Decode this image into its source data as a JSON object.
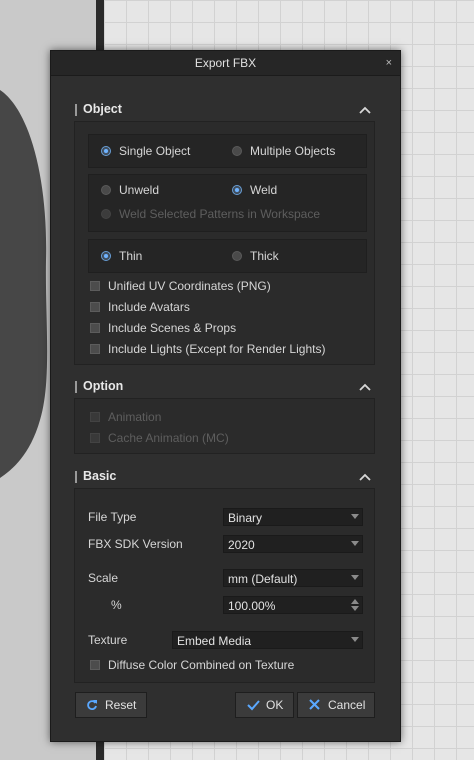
{
  "dialog": {
    "title": "Export FBX",
    "close_glyph": "×"
  },
  "sections": {
    "object": {
      "title": "Object",
      "object_mode": {
        "options": [
          "Single Object",
          "Multiple Objects"
        ],
        "selected": "Single Object"
      },
      "weld_mode": {
        "options": [
          "Unweld",
          "Weld"
        ],
        "selected": "Weld"
      },
      "weld_patterns_label": "Weld Selected Patterns in Workspace",
      "thickness": {
        "options": [
          "Thin",
          "Thick"
        ],
        "selected": "Thin"
      },
      "checks": [
        "Unified UV Coordinates (PNG)",
        "Include Avatars",
        "Include Scenes & Props",
        "Include Lights (Except for Render Lights)"
      ]
    },
    "option": {
      "title": "Option",
      "checks": [
        "Animation",
        "Cache Animation (MC)"
      ]
    },
    "basic": {
      "title": "Basic",
      "file_type_label": "File Type",
      "file_type_value": "Binary",
      "sdk_label": "FBX SDK Version",
      "sdk_value": "2020",
      "scale_label": "Scale",
      "scale_value": "mm (Default)",
      "percent_label": "%",
      "percent_value": "100.00%",
      "texture_label": "Texture",
      "texture_value": "Embed Media",
      "diffuse_label": "Diffuse Color Combined on Texture"
    }
  },
  "buttons": {
    "reset": "Reset",
    "ok": "OK",
    "cancel": "Cancel"
  },
  "colors": {
    "accent": "#6fb3ff",
    "ok_icon": "#5aa8ff",
    "cancel_icon": "#5aa8ff",
    "dialog_bg": "#2f2f2f"
  },
  "icons": [
    "chevron-up-icon",
    "dropdown-arrow-icon",
    "spin-arrows-icon",
    "reset-icon",
    "check-icon",
    "x-icon",
    "close-icon"
  ]
}
